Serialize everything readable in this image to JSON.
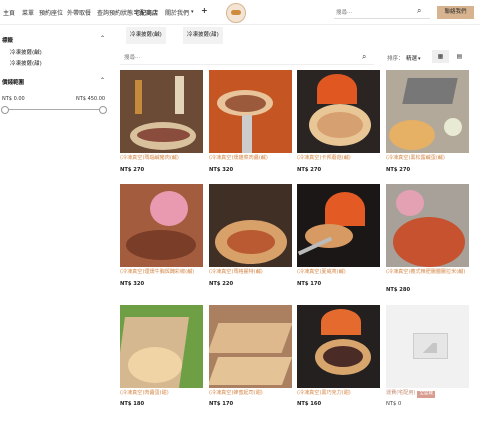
{
  "nav": {
    "items": [
      {
        "label": "主頁"
      },
      {
        "label": "菜單"
      },
      {
        "label": "預約座位"
      },
      {
        "label": "外帶取餐"
      },
      {
        "label": "查詢預約狀態"
      },
      {
        "label": "宅配商店"
      },
      {
        "label": "關於我們"
      }
    ],
    "search_placeholder": "搜尋⋯",
    "contact_label": "聯絡我們",
    "icons": {
      "chevron": "chevron-down-icon",
      "plus": "plus-icon",
      "search": "search-icon",
      "logo": "pizza-logo"
    }
  },
  "sidebar": {
    "category_title": "標籤",
    "category_items": [
      {
        "label": "冷凍披薩(鹹)"
      },
      {
        "label": "冷凍披薩(甜)"
      }
    ],
    "price_title": "價錢範圍",
    "price_min": "NT$ 0.00",
    "price_max": "NT$ 450.00"
  },
  "toolbar": {
    "tabs": [
      {
        "label": "冷凍披薩(鹹)"
      },
      {
        "label": "冷凍披薩(甜)"
      }
    ],
    "search_placeholder": "搜尋⋯",
    "sort_label": "排序：",
    "sort_value": "精選"
  },
  "products": [
    {
      "title": "(冷凍真空)瑪瑙鹹豬肉(鹹)",
      "price": "NT$ 270",
      "image": "pizza with bacon and bottles"
    },
    {
      "title": "(冷凍真空)燻雞菜肉醬(鹹)",
      "price": "NT$ 320",
      "image": "pizza on peel at oven"
    },
    {
      "title": "(冷凍真空)卡邦蘑菇(鹹)",
      "price": "NT$ 270",
      "image": "pizza at brick oven"
    },
    {
      "title": "(冷凍真空)黑松露鹹蛋(鹹)",
      "price": "NT$ 270",
      "image": "pizza with laptop"
    },
    {
      "title": "(冷凍真空)煙燻牛胸與醃彩椒(鹹)",
      "price": "NT$ 320",
      "image": "pizza with flowers"
    },
    {
      "title": "(冷凍真空)瑪格麗特(鹹)",
      "price": "NT$ 220",
      "image": "margherita pizza"
    },
    {
      "title": "(冷凍真空)夏威夷(鹹)",
      "price": "NT$ 170",
      "image": "pizza on peel in oven"
    },
    {
      "title": "(冷凍真空)義式辣肥腸臘腸拉米(鹹)",
      "price": "NT$ 280",
      "image": "pepperoni pizza"
    },
    {
      "title": "(冷凍真空)肉醬蛋(甜)",
      "price": "NT$ 180",
      "image": "pizza box with greenery"
    },
    {
      "title": "(冷凍真空)蜂蜜起司(甜)",
      "price": "NT$ 170",
      "image": "pizzas on cooling rack"
    },
    {
      "title": "(冷凍真空)黑巧克力(甜)",
      "price": "NT$ 160",
      "image": "chocolate pizza"
    },
    {
      "title": "運費(宅配用)",
      "price": "NT$ 0",
      "badge": "全盆栽",
      "image": "placeholder"
    }
  ]
}
